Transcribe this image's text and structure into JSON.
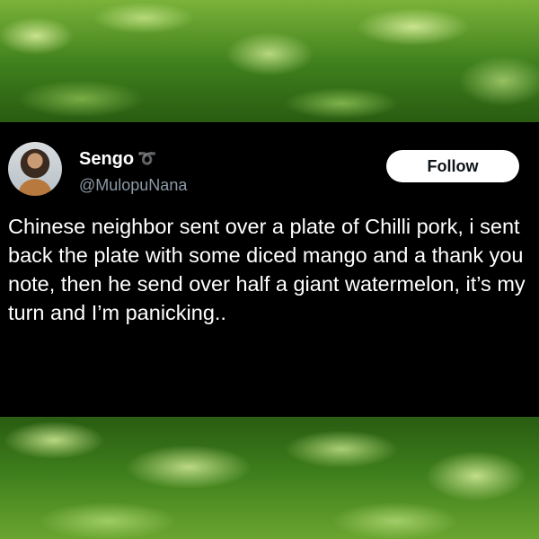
{
  "tweet": {
    "display_name": "Sengo",
    "name_emoji": "➰",
    "handle": "@MulopuNana",
    "follow_label": "Follow",
    "text": "Chinese neighbor sent over a plate of Chilli pork, i sent back the plate with some diced mango and a thank you note, then he send over half a giant watermelon, it’s my turn and I’m panicking.."
  },
  "colors": {
    "card_background": "#000000",
    "text_primary": "#ffffff",
    "text_secondary": "#8b98a5",
    "follow_button": "#ffffff",
    "background_theme": "#2f6b18"
  },
  "icons": {
    "background": "watermelon-rind-texture",
    "avatar": "profile-photo"
  }
}
